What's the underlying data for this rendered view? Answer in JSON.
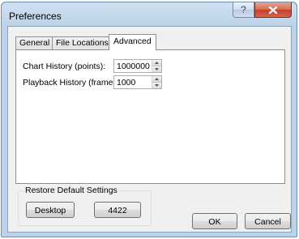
{
  "window": {
    "title": "Preferences",
    "help_label": "?",
    "close_label": "close"
  },
  "tabs": [
    {
      "label": "General",
      "selected": false
    },
    {
      "label": "File Locations",
      "selected": false
    },
    {
      "label": "Advanced",
      "selected": true
    }
  ],
  "settings": [
    {
      "label": "Chart History (points):",
      "value": "1000000"
    },
    {
      "label": "Playback History (frames):",
      "value": "1000"
    }
  ],
  "restore": {
    "group_label": "Restore Default Settings",
    "buttons": [
      "Desktop",
      "4422"
    ]
  },
  "footer": {
    "ok_label": "OK",
    "cancel_label": "Cancel"
  }
}
